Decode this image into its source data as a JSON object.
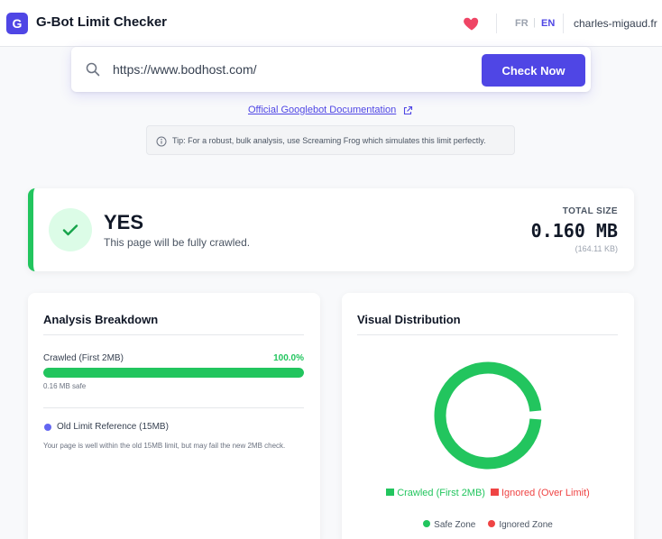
{
  "header": {
    "logo_letter": "G",
    "title": "G-Bot Limit Checker",
    "lang_fr": "FR",
    "lang_separator": "|",
    "lang_en": "EN",
    "user": "charles-migaud.fr"
  },
  "search": {
    "value": "https://www.bodhost.com/",
    "button_label": "Check Now"
  },
  "doc_link": "Official Googlebot Documentation",
  "tip": "Tip: For a robust, bulk analysis, use Screaming Frog which simulates this limit perfectly.",
  "result": {
    "verdict": "YES",
    "description": "This page will be fully crawled.",
    "total_label": "TOTAL SIZE",
    "total_mb": "0.160 MB",
    "total_kb": "(164.11 KB)"
  },
  "breakdown": {
    "title": "Analysis Breakdown",
    "crawled_label": "Crawled (First 2MB)",
    "crawled_pct": "100.0%",
    "crawled_fraction": 1.0,
    "safe_note": "0.16 MB safe",
    "old_label": "Old Limit Reference (15MB)",
    "old_desc": "Your page is well within the old 15MB limit, but may fail the new 2MB check."
  },
  "distribution": {
    "title": "Visual Distribution",
    "legend_crawled": "Crawled (First 2MB)",
    "legend_ignored": "Ignored (Over Limit)",
    "legend_safe": "Safe Zone",
    "legend_ignored_zone": "Ignored Zone",
    "crawled_share": 0.985,
    "colors": {
      "safe": "#22c55e",
      "ignored": "#ef4444"
    }
  },
  "icons": {
    "heart": "heart-icon",
    "search": "search-icon",
    "external": "external-link-icon",
    "info": "info-icon",
    "check": "check-icon"
  },
  "colors": {
    "accent": "#4f46e5",
    "success": "#22c55e",
    "danger": "#ef4444",
    "heart": "#ef4565"
  }
}
